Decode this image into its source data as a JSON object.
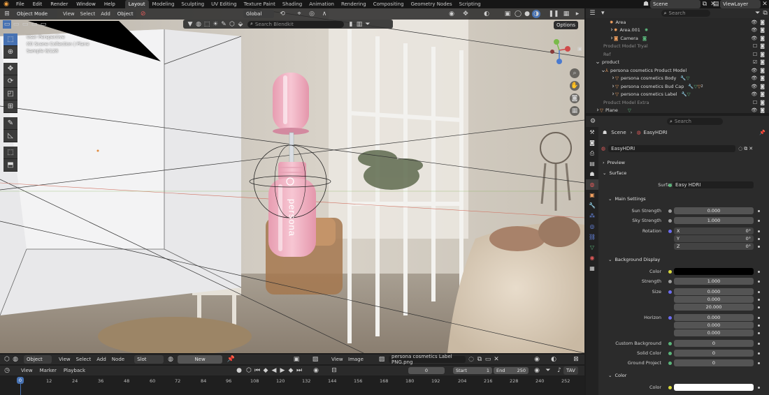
{
  "topbar": {
    "menus": [
      "File",
      "Edit",
      "Render",
      "Window",
      "Help"
    ],
    "workspaces": [
      "Layout",
      "Modeling",
      "Sculpting",
      "UV Editing",
      "Texture Paint",
      "Shading",
      "Animation",
      "Rendering",
      "Compositing",
      "Geometry Nodes",
      "Scripting"
    ],
    "active_workspace": "Layout",
    "scene": "Scene",
    "view_layer": "ViewLayer"
  },
  "viewport": {
    "mode": "Object Mode",
    "menus": [
      "View",
      "Select",
      "Add",
      "Object"
    ],
    "orientation": "Global",
    "search_placeholder": "Search Blendkit",
    "options": "Options",
    "overlay_title": "User Perspective",
    "overlay_collection": "(0) Scene Collection | Plane",
    "overlay_sample": "Sample 8/128",
    "product_text": "persona"
  },
  "outliner": {
    "search_placeholder": "Search",
    "rows": [
      {
        "name": "Area",
        "indent": 2
      },
      {
        "name": "Area.001",
        "indent": 2
      },
      {
        "name": "Camera",
        "indent": 2
      },
      {
        "name": "Product Model Tryal",
        "indent": 1
      },
      {
        "name": "Ref",
        "indent": 1
      },
      {
        "name": "product",
        "indent": 1
      },
      {
        "name": "persona cosmetics Product Model",
        "indent": 2
      },
      {
        "name": "persona cosmetics Body",
        "indent": 3
      },
      {
        "name": "persona cosmetics Bud Cap",
        "indent": 3
      },
      {
        "name": "persona cosmetics Label",
        "indent": 3
      },
      {
        "name": "Product Model Extra",
        "indent": 1
      },
      {
        "name": "Plane",
        "indent": 1
      }
    ],
    "badge": "2"
  },
  "properties": {
    "search_placeholder": "Search",
    "breadcrumb_scene": "Scene",
    "breadcrumb_world": "EasyHDRI",
    "world_name": "EasyHDRI",
    "preview": "Preview",
    "surface": "Surface",
    "surface_label": "Surface",
    "surface_value": "Easy HDRI",
    "main_settings": "Main Settings",
    "sun_strength_label": "Sun Strength",
    "sun_strength": "0.000",
    "sky_strength_label": "Sky Strength",
    "sky_strength": "1.000",
    "rotation_label": "Rotation",
    "rot_x_label": "X",
    "rot_x": "0°",
    "rot_y_label": "Y",
    "rot_y": "0°",
    "rot_z_label": "Z",
    "rot_z": "0°",
    "background_display": "Background Display",
    "color_label": "Color",
    "strength_label": "Strength",
    "strength": "1.000",
    "size_label": "Size",
    "size_values": [
      "0.000",
      "0.000",
      "20.000"
    ],
    "horizon_label": "Horizon",
    "horizon_values": [
      "0.000",
      "0.000",
      "0.000"
    ],
    "custom_background_label": "Custom Background",
    "custom_background": "0",
    "solid_color_label": "Solid Color",
    "solid_color": "0",
    "ground_project_label": "Ground Project",
    "ground_project": "0",
    "color_section": "Color",
    "color2_label": "Color"
  },
  "shader_bar": {
    "object": "Object",
    "menus": [
      "View",
      "Select",
      "Add",
      "Node"
    ],
    "slot": "Slot",
    "new": "New",
    "image_menus": [
      "View",
      "Image"
    ],
    "image_name": "persona cosmetics Label PNG.png"
  },
  "timeline": {
    "menus": [
      "View",
      "Marker",
      "Playback"
    ],
    "current_frame": "0",
    "start_label": "Start",
    "start": "1",
    "end_label": "End",
    "end": "250",
    "tav": "TAV",
    "ticks": [
      "0",
      "12",
      "24",
      "36",
      "48",
      "60",
      "72",
      "84",
      "96",
      "108",
      "120",
      "132",
      "144",
      "156",
      "168",
      "180",
      "192",
      "204",
      "216",
      "228",
      "240",
      "252"
    ]
  },
  "colors": {
    "accent": "#4772b3",
    "bottle_pink": "#f1b6c6",
    "bg_color": "#000000",
    "color2": "#ffffff"
  }
}
